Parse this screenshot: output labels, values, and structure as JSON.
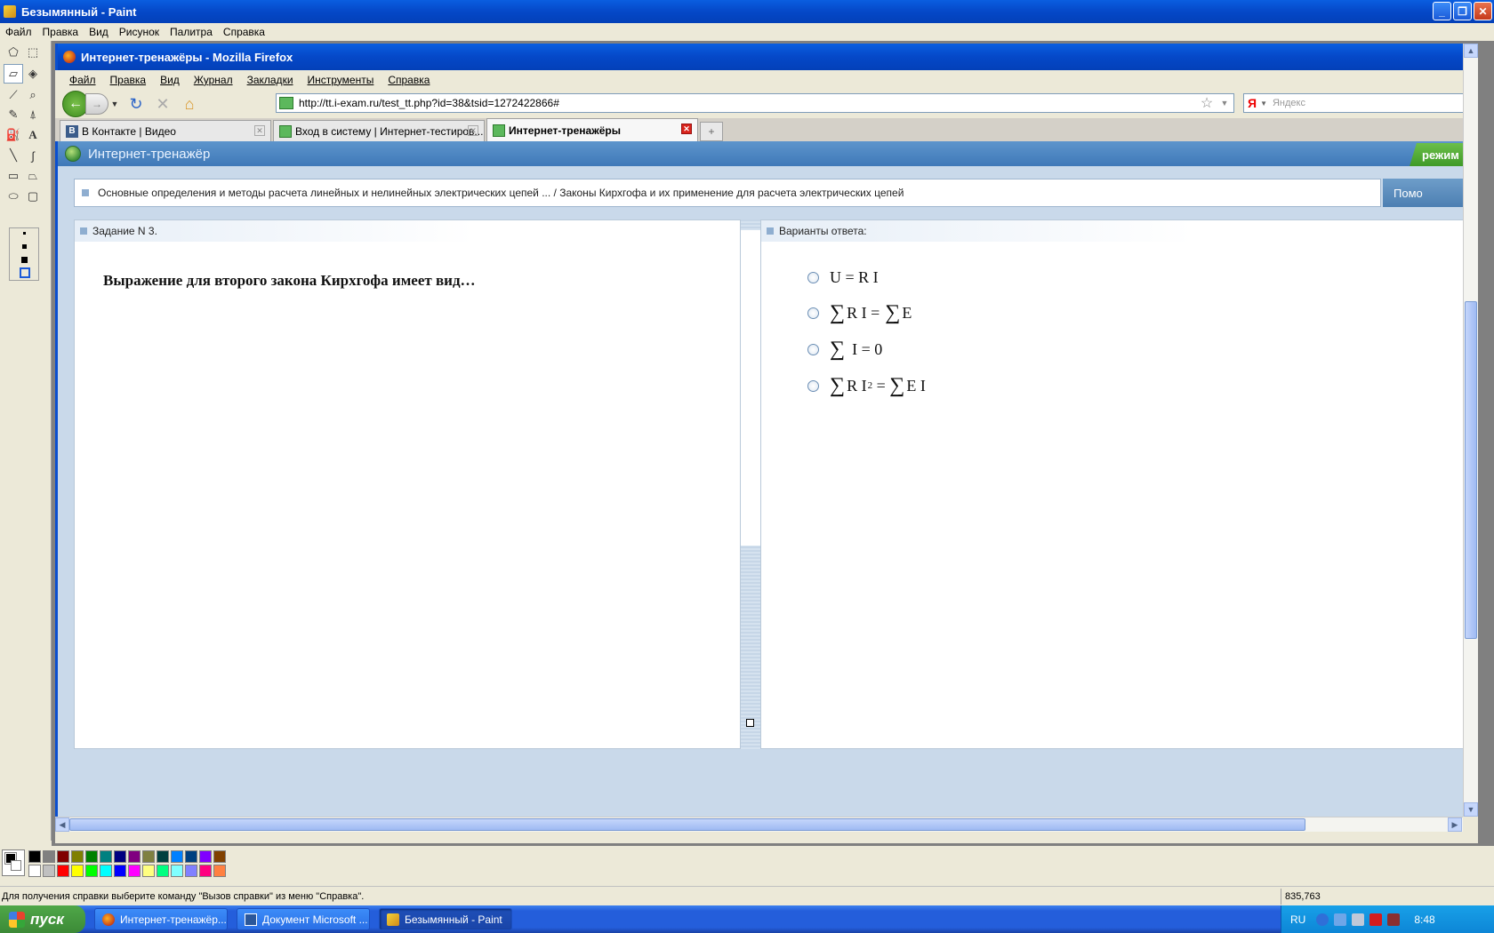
{
  "paint": {
    "title": "Безымянный - Paint",
    "menu": [
      "Файл",
      "Правка",
      "Вид",
      "Рисунок",
      "Палитра",
      "Справка"
    ],
    "status_text": "Для получения справки выберите команду \"Вызов справки\" из меню \"Справка\".",
    "coords": "835,763"
  },
  "firefox": {
    "title": "Интернет-тренажёры - Mozilla Firefox",
    "menu": [
      "Файл",
      "Правка",
      "Вид",
      "Журнал",
      "Закладки",
      "Инструменты",
      "Справка"
    ],
    "url": "http://tt.i-exam.ru/test_tt.php?id=38&tsid=1272422866#",
    "search_placeholder": "Яндекс",
    "search_logo": "Я",
    "tabs": [
      {
        "label": "В Контакте | Видео",
        "icon": "vk-icon"
      },
      {
        "label": "Вход в систему | Интернет-тестиров...",
        "icon": "site-icon"
      },
      {
        "label": "Интернет-тренажёры",
        "icon": "site-icon"
      }
    ]
  },
  "page": {
    "header_title": "Интернет-тренажёр",
    "mode_badge": "режим \"",
    "breadcrumb": "Основные определения и методы расчета линейных и нелинейных электрических цепей ... / Законы Кирхгофа и их применение для расчета электрических цепей",
    "help": "Помо",
    "task_label": "Задание N 3.",
    "question": "Выражение для второго закона Кирхгофа имеет вид…",
    "answers_label": "Варианты ответа:",
    "options": {
      "o1": "U = R I",
      "o2_a": "∑",
      "o2_b": "R I = ",
      "o2_c": "∑",
      "o2_d": "E",
      "o3_a": "∑",
      "o3_b": "I = 0",
      "o4_a": "∑",
      "o4_b": "R I",
      "o4_sup": "2",
      "o4_c": " = ",
      "o4_d": "∑",
      "o4_e": "E I"
    }
  },
  "taskbar": {
    "start": "пуск",
    "items": [
      "Интернет-тренажёр...",
      "Документ Microsoft ...",
      "Безымянный - Paint"
    ],
    "lang": "RU",
    "clock": "8:48"
  }
}
